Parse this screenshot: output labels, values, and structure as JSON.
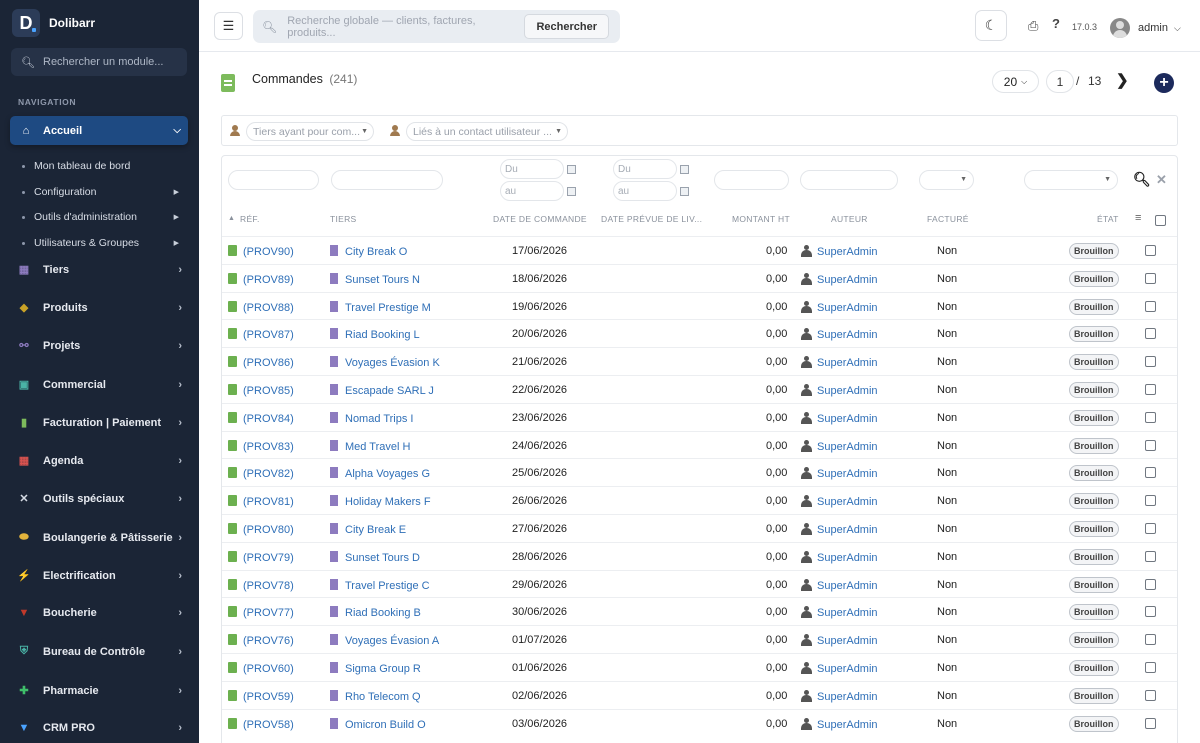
{
  "app": {
    "name": "Dolibarr",
    "logo_letter": "D",
    "version": "17.0.3",
    "user": "admin",
    "accent": "#1e4a82",
    "sidebar_bg": "#1b2536"
  },
  "sidebar": {
    "search_placeholder": "Rechercher un module...",
    "section_label": "NAVIGATION",
    "active": {
      "label": "Accueil",
      "icon": "home-icon"
    },
    "subitems": [
      {
        "label": "Mon tableau de bord",
        "has_arrow": false
      },
      {
        "label": "Configuration",
        "has_arrow": true
      },
      {
        "label": "Outils d'administration",
        "has_arrow": true
      },
      {
        "label": "Utilisateurs & Groupes",
        "has_arrow": true
      }
    ],
    "items": [
      {
        "label": "Tiers",
        "icon": "building-icon",
        "glyph": "▦",
        "color": "#8d7bbf"
      },
      {
        "label": "Produits",
        "icon": "cube-icon",
        "glyph": "◆",
        "color": "#c9a227"
      },
      {
        "label": "Projets",
        "icon": "sitemap-icon",
        "glyph": "⚯",
        "color": "#8d7bbf"
      },
      {
        "label": "Commercial",
        "icon": "briefcase-icon",
        "glyph": "▣",
        "color": "#4ab3a6"
      },
      {
        "label": "Facturation | Paiement",
        "icon": "invoice-icon",
        "glyph": "▮",
        "color": "#7dbb5c"
      },
      {
        "label": "Agenda",
        "icon": "calendar-icon",
        "glyph": "▦",
        "color": "#d9534f"
      },
      {
        "label": "Outils spéciaux",
        "icon": "tools-icon",
        "glyph": "✕",
        "color": "#d6dbe4"
      },
      {
        "label": "Boulangerie & Pâtisserie",
        "icon": "bread-icon",
        "glyph": "⬬",
        "color": "#e2b33c"
      },
      {
        "label": "Electrification",
        "icon": "bolt-icon",
        "glyph": "⚡",
        "color": "#f2c230"
      },
      {
        "label": "Boucherie",
        "icon": "meat-icon",
        "glyph": "▼",
        "color": "#c0392b"
      },
      {
        "label": "Bureau de Contrôle",
        "icon": "shield-icon",
        "glyph": "⛨",
        "color": "#4ab3a6"
      },
      {
        "label": "Pharmacie",
        "icon": "cross-icon",
        "glyph": "✚",
        "color": "#3fbf6a"
      },
      {
        "label": "CRM PRO",
        "icon": "funnel-icon",
        "glyph": "▼",
        "color": "#4aa3ff"
      }
    ]
  },
  "topbar": {
    "search_placeholder": "Recherche globale — clients, factures, produits...",
    "search_button": "Rechercher"
  },
  "page": {
    "title": "Commandes",
    "count": "(241)",
    "per_page": "20",
    "current_page": "1",
    "separator": "/",
    "total_pages": "13"
  },
  "filters": {
    "thirdparty_placeholder": "Tiers ayant pour com...",
    "contact_placeholder": "Liés à un contact utilisateur ...",
    "date_from": "Du",
    "date_to": "au"
  },
  "table": {
    "columns": {
      "ref": "RÉF.",
      "thirdparty": "TIERS",
      "order_date": "DATE DE COMMANDE",
      "delivery_date": "DATE PRÉVUE DE LIV...",
      "amount": "MONTANT HT",
      "author": "AUTEUR",
      "billed": "FACTURÉ",
      "status": "ÉTAT"
    },
    "rows": [
      {
        "ref": "(PROV90)",
        "tiers": "City Break O",
        "date": "17/06/2026",
        "amount": "0,00",
        "author": "SuperAdmin",
        "billed": "Non",
        "status": "Brouillon"
      },
      {
        "ref": "(PROV89)",
        "tiers": "Sunset Tours N",
        "date": "18/06/2026",
        "amount": "0,00",
        "author": "SuperAdmin",
        "billed": "Non",
        "status": "Brouillon"
      },
      {
        "ref": "(PROV88)",
        "tiers": "Travel Prestige M",
        "date": "19/06/2026",
        "amount": "0,00",
        "author": "SuperAdmin",
        "billed": "Non",
        "status": "Brouillon"
      },
      {
        "ref": "(PROV87)",
        "tiers": "Riad Booking L",
        "date": "20/06/2026",
        "amount": "0,00",
        "author": "SuperAdmin",
        "billed": "Non",
        "status": "Brouillon"
      },
      {
        "ref": "(PROV86)",
        "tiers": "Voyages Évasion K",
        "date": "21/06/2026",
        "amount": "0,00",
        "author": "SuperAdmin",
        "billed": "Non",
        "status": "Brouillon"
      },
      {
        "ref": "(PROV85)",
        "tiers": "Escapade SARL J",
        "date": "22/06/2026",
        "amount": "0,00",
        "author": "SuperAdmin",
        "billed": "Non",
        "status": "Brouillon"
      },
      {
        "ref": "(PROV84)",
        "tiers": "Nomad Trips I",
        "date": "23/06/2026",
        "amount": "0,00",
        "author": "SuperAdmin",
        "billed": "Non",
        "status": "Brouillon"
      },
      {
        "ref": "(PROV83)",
        "tiers": "Med Travel H",
        "date": "24/06/2026",
        "amount": "0,00",
        "author": "SuperAdmin",
        "billed": "Non",
        "status": "Brouillon"
      },
      {
        "ref": "(PROV82)",
        "tiers": "Alpha Voyages G",
        "date": "25/06/2026",
        "amount": "0,00",
        "author": "SuperAdmin",
        "billed": "Non",
        "status": "Brouillon"
      },
      {
        "ref": "(PROV81)",
        "tiers": "Holiday Makers F",
        "date": "26/06/2026",
        "amount": "0,00",
        "author": "SuperAdmin",
        "billed": "Non",
        "status": "Brouillon"
      },
      {
        "ref": "(PROV80)",
        "tiers": "City Break E",
        "date": "27/06/2026",
        "amount": "0,00",
        "author": "SuperAdmin",
        "billed": "Non",
        "status": "Brouillon"
      },
      {
        "ref": "(PROV79)",
        "tiers": "Sunset Tours D",
        "date": "28/06/2026",
        "amount": "0,00",
        "author": "SuperAdmin",
        "billed": "Non",
        "status": "Brouillon"
      },
      {
        "ref": "(PROV78)",
        "tiers": "Travel Prestige C",
        "date": "29/06/2026",
        "amount": "0,00",
        "author": "SuperAdmin",
        "billed": "Non",
        "status": "Brouillon"
      },
      {
        "ref": "(PROV77)",
        "tiers": "Riad Booking B",
        "date": "30/06/2026",
        "amount": "0,00",
        "author": "SuperAdmin",
        "billed": "Non",
        "status": "Brouillon"
      },
      {
        "ref": "(PROV76)",
        "tiers": "Voyages Évasion A",
        "date": "01/07/2026",
        "amount": "0,00",
        "author": "SuperAdmin",
        "billed": "Non",
        "status": "Brouillon"
      },
      {
        "ref": "(PROV60)",
        "tiers": "Sigma Group R",
        "date": "01/06/2026",
        "amount": "0,00",
        "author": "SuperAdmin",
        "billed": "Non",
        "status": "Brouillon"
      },
      {
        "ref": "(PROV59)",
        "tiers": "Rho Telecom Q",
        "date": "02/06/2026",
        "amount": "0,00",
        "author": "SuperAdmin",
        "billed": "Non",
        "status": "Brouillon"
      },
      {
        "ref": "(PROV58)",
        "tiers": "Omicron Build O",
        "date": "03/06/2026",
        "amount": "0,00",
        "author": "SuperAdmin",
        "billed": "Non",
        "status": "Brouillon"
      }
    ]
  }
}
